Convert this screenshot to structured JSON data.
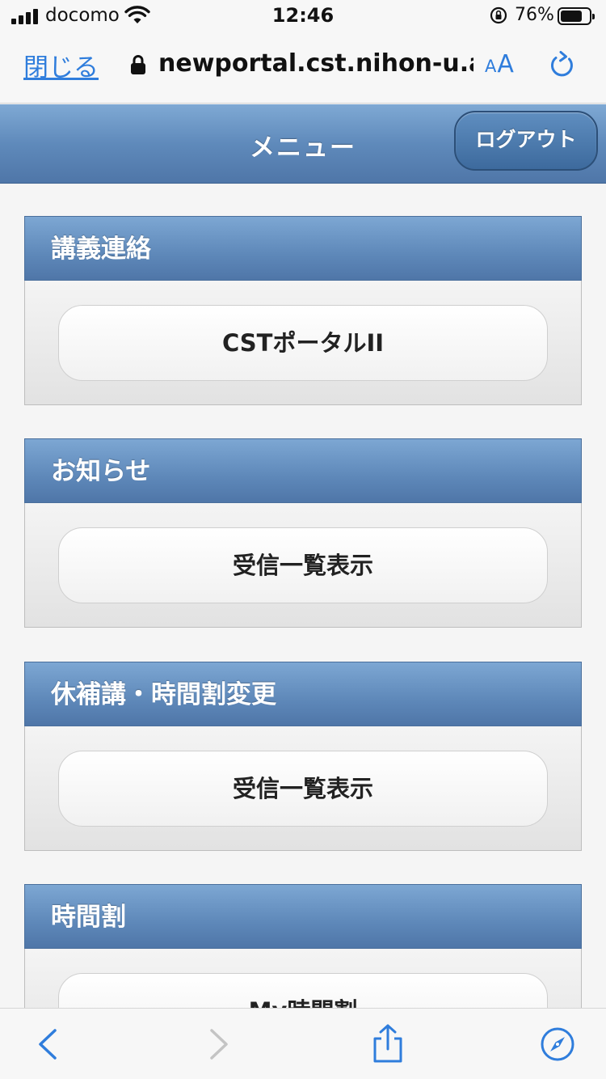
{
  "status_bar": {
    "carrier": "docomo",
    "time": "12:46",
    "battery_percent": "76%",
    "battery_level": 0.76
  },
  "browser": {
    "close_label": "閉じる",
    "url": "newportal.cst.nihon-u.a",
    "text_size_label_small": "A",
    "text_size_label_large": "A"
  },
  "header": {
    "title": "メニュー",
    "logout_label": "ログアウト"
  },
  "sections": [
    {
      "title": "講義連絡",
      "button_label": "CSTポータルII"
    },
    {
      "title": "お知らせ",
      "button_label": "受信一覧表示"
    },
    {
      "title": "休補講・時間割変更",
      "button_label": "受信一覧表示"
    },
    {
      "title": "時間割",
      "button_label": "My時間割"
    }
  ],
  "colors": {
    "accent": "#2f7ddc",
    "header_blue": "#5f8abb"
  },
  "icons": {
    "back": "chevron-left-icon",
    "forward": "chevron-right-icon",
    "share": "share-icon",
    "bookmarks": "compass-icon"
  }
}
